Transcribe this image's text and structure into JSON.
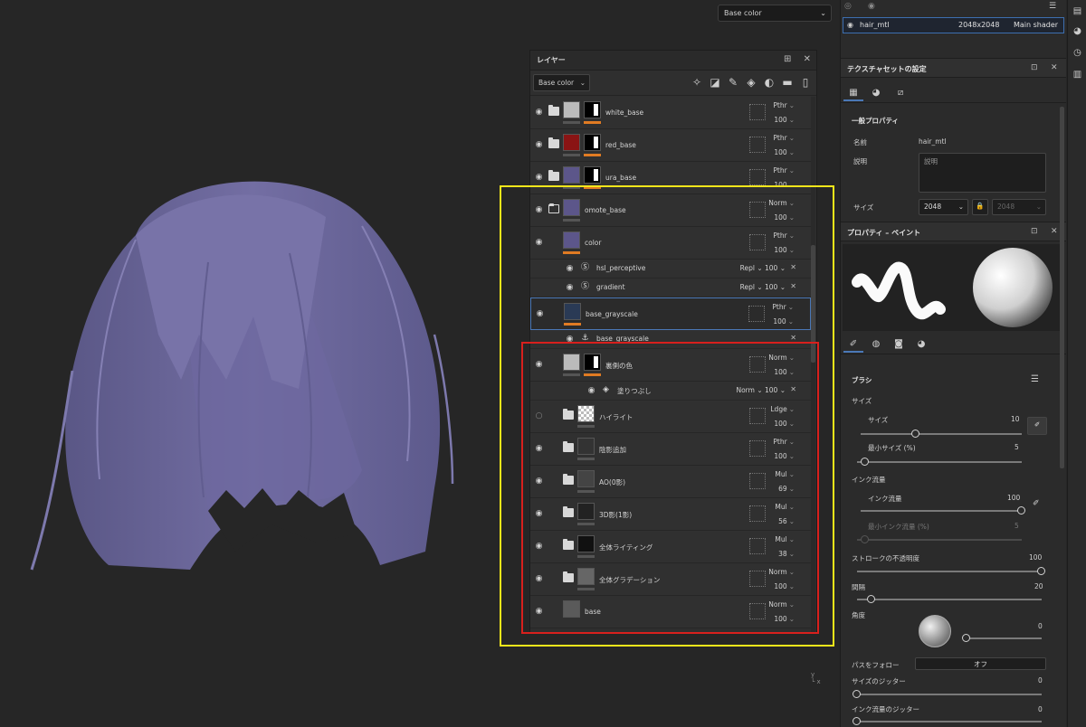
{
  "viewport": {
    "channel_select": "Base color",
    "axis": "x",
    "hair_color": "#6e6a9a"
  },
  "layers_panel": {
    "title": "レイヤー",
    "channel_select": "Base color",
    "tools": [
      "magic-wand-icon",
      "fill-layer-icon",
      "paint-icon",
      "fill-icon",
      "effect-icon",
      "folder-icon",
      "delete-icon"
    ],
    "layers": [
      {
        "name": "white_base",
        "blend": "Pthr",
        "opacity": "100",
        "visible": true,
        "folder": true
      },
      {
        "name": "red_base",
        "blend": "Pthr",
        "opacity": "100",
        "visible": true,
        "folder": true
      },
      {
        "name": "ura_base",
        "blend": "Pthr",
        "opacity": "100",
        "visible": true,
        "folder": true
      },
      {
        "name": "omote_base",
        "blend": "Norm",
        "opacity": "100",
        "visible": true,
        "folder": true
      },
      {
        "name": "color",
        "blend": "Pthr",
        "opacity": "100",
        "visible": true,
        "folder": false
      },
      {
        "name": "hsl_perceptive",
        "blend": "Repl",
        "opacity": "100"
      },
      {
        "name": "gradient",
        "blend": "Repl",
        "opacity": "100"
      },
      {
        "name": "base_grayscale",
        "blend": "Pthr",
        "opacity": "100",
        "visible": true,
        "folder": false
      },
      {
        "name": "base_grayscale"
      },
      {
        "name": "裏側の色",
        "blend": "Norm",
        "opacity": "100",
        "visible": true,
        "folder": false
      },
      {
        "name": "塗りつぶし",
        "blend": "Norm",
        "opacity": "100"
      },
      {
        "name": "ハイライト",
        "blend": "Ldge",
        "opacity": "100",
        "visible": false,
        "folder": true
      },
      {
        "name": "陰影追加",
        "blend": "Pthr",
        "opacity": "100",
        "visible": true,
        "folder": true
      },
      {
        "name": "AO(0影)",
        "blend": "Mul",
        "opacity": "69",
        "visible": true,
        "folder": true
      },
      {
        "name": "3D影(1影)",
        "blend": "Mul",
        "opacity": "56",
        "visible": true,
        "folder": true
      },
      {
        "name": "全体ライティング",
        "blend": "Mul",
        "opacity": "38",
        "visible": true,
        "folder": true
      },
      {
        "name": "全体グラデーション",
        "blend": "Norm",
        "opacity": "100",
        "visible": true,
        "folder": true
      },
      {
        "name": "base",
        "blend": "Norm",
        "opacity": "100",
        "visible": true,
        "folder": false
      }
    ]
  },
  "texture_set": {
    "name": "hair_mtl",
    "resolution": "2048x2048",
    "shader": "Main shader"
  },
  "texture_settings": {
    "title": "テクスチャセットの設定",
    "section": "一般プロパティ",
    "name_label": "名前",
    "name_value": "hair_mtl",
    "desc_label": "説明",
    "desc_placeholder": "説明",
    "size_label": "サイズ",
    "size_value": "2048",
    "size_value2": "2048"
  },
  "paint_props": {
    "title": "プロパティ – ペイント",
    "brush_label": "ブラシ",
    "size_section": "サイズ",
    "size_label": "サイズ",
    "size_value": "10",
    "min_size_label": "最小サイズ (%)",
    "min_size_value": "5",
    "ink_section": "インク流量",
    "ink_label": "インク流量",
    "ink_value": "100",
    "min_ink_label": "最小インク流量 (%)",
    "min_ink_value": "5",
    "stroke_opacity_label": "ストロークの不透明度",
    "stroke_opacity_value": "100",
    "spacing_label": "間隔",
    "spacing_value": "20",
    "angle_label": "角度",
    "angle_value": "0",
    "follow_path_label": "パスをフォロー",
    "follow_path_value": "オフ",
    "size_jitter_label": "サイズのジッター",
    "size_jitter_value": "0",
    "ink_jitter_label": "インク流量のジッター",
    "ink_jitter_value": "0"
  },
  "sliders": {
    "size": 0.34,
    "min_size": 0.05,
    "ink": 1.0,
    "min_ink": 0.05,
    "stroke_opacity": 1.0,
    "spacing": 0.08,
    "size_jitter": 0.0,
    "ink_jitter": 0.0
  },
  "colors": {
    "accent": "#4a78b6",
    "orange": "#e07b23",
    "highlight_yellow": "#f4e61a",
    "highlight_red": "#d8201d"
  }
}
